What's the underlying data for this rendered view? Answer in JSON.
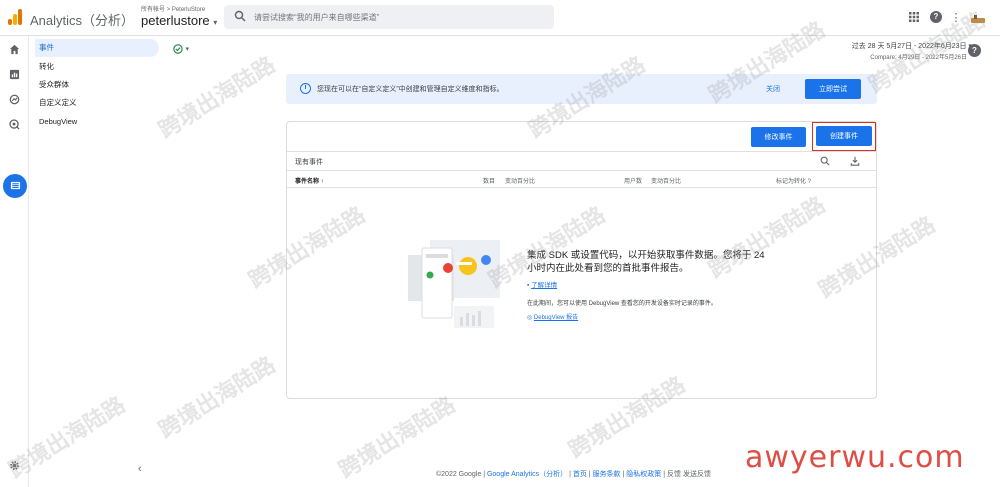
{
  "topbar": {
    "app_title": "Analytics（分析）",
    "account_path": "所有帐号 > PeterluStore",
    "account_name": "peterlustore",
    "search_placeholder": "请尝试搜索“我的用户来自哪些渠道”",
    "icons": [
      "apps-grid-icon",
      "help-icon",
      "more-vert-icon",
      "avatar"
    ]
  },
  "rail": {
    "icons": [
      "home-icon",
      "reports-icon",
      "explore-icon",
      "advertising-icon",
      "configure-icon",
      "settings-icon"
    ]
  },
  "sidenav": {
    "items": [
      {
        "label": "事件",
        "active": true
      },
      {
        "label": "转化",
        "active": false
      },
      {
        "label": "受众群体",
        "active": false
      },
      {
        "label": "自定义定义",
        "active": false
      },
      {
        "label": "DebugView",
        "active": false
      }
    ],
    "collapse": "‹"
  },
  "header": {
    "date_range": "过去 28 天   5月27日 - 2022年6月23日 ▾",
    "compare": "Compare: 4月29日 - 2022年5月26日",
    "help": "?"
  },
  "banner": {
    "text": "您现在可以在“自定义定义”中创建和管理自定义维度和指标。",
    "close_label": "关闭",
    "try_label": "立即尝试"
  },
  "card": {
    "modify_label": "修改事件",
    "create_label": "创建事件",
    "table_title": "现有事件",
    "columns": [
      "事件名称 ↑",
      "数目",
      "变动百分比",
      "用户数",
      "变动百分比",
      "标记为转化 ?"
    ],
    "empty_title": "集成 SDK 或设置代码，以开始获取事件数据。您将于 24 小时内在此处看到您的首批事件报告。",
    "learn_more": "了解详情",
    "debug_text": "在此期间，您可以使用 DebugView 查看您的开发设备实时记录的事件。",
    "debug_link": "DebugView 报告"
  },
  "footer": {
    "copyright": "©2022 Google | ",
    "ga_link": "Google Analytics（分析）",
    "home": "首页",
    "terms": "服务条款",
    "privacy": "隐私权政策",
    "feedback": "| 反馈 发送反馈"
  },
  "watermark": {
    "text": "跨境出海陆路",
    "site": "awyerwu.com"
  },
  "colors": {
    "accent": "#1a73e8",
    "highlight": "#d93025",
    "active_nav": "#e8f0fe"
  }
}
